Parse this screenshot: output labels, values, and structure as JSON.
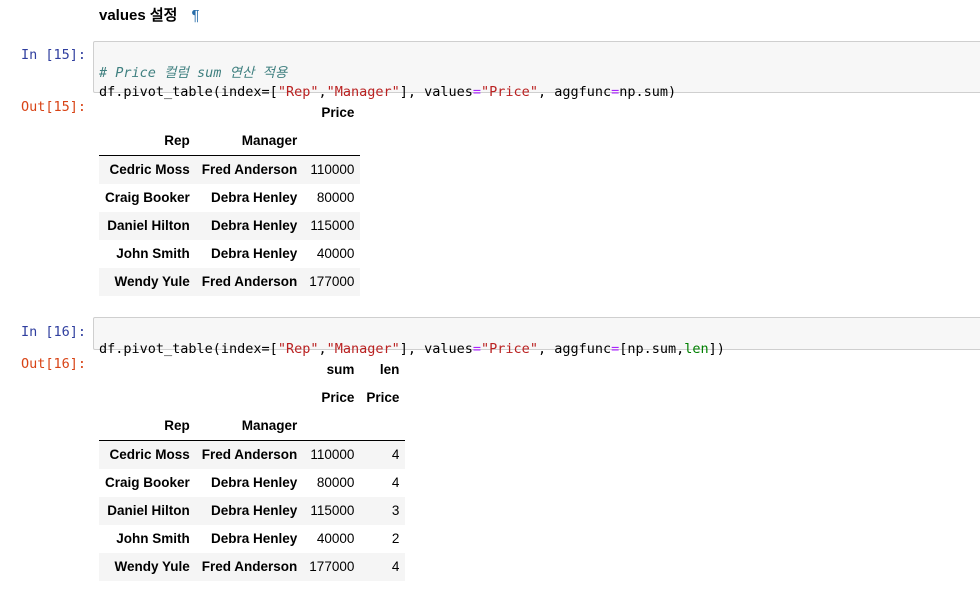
{
  "heading": {
    "text": "values 설정",
    "pilcrow": "¶"
  },
  "cell15": {
    "in_prompt": "In [15]:",
    "out_prompt": "Out[15]:",
    "comment": "# Price 컬럼 sum 연산 적용",
    "code_parts": [
      "df.pivot_table(index=[",
      "\"Rep\"",
      ",",
      "\"Manager\"",
      "], values",
      "=",
      "\"Price\"",
      ", aggfunc",
      "=",
      "np.sum)"
    ],
    "table": {
      "col_header": "Price",
      "index_names": [
        "Rep",
        "Manager"
      ],
      "rows": [
        {
          "rep": "Cedric Moss",
          "manager": "Fred Anderson",
          "price": "110000"
        },
        {
          "rep": "Craig Booker",
          "manager": "Debra Henley",
          "price": "80000"
        },
        {
          "rep": "Daniel Hilton",
          "manager": "Debra Henley",
          "price": "115000"
        },
        {
          "rep": "John Smith",
          "manager": "Debra Henley",
          "price": "40000"
        },
        {
          "rep": "Wendy Yule",
          "manager": "Fred Anderson",
          "price": "177000"
        }
      ]
    }
  },
  "cell16": {
    "in_prompt": "In [16]:",
    "out_prompt": "Out[16]:",
    "code_parts": [
      "df.pivot_table(index=[",
      "\"Rep\"",
      ",",
      "\"Manager\"",
      "], values",
      "=",
      "\"Price\"",
      ", aggfunc",
      "=",
      "[np.sum,",
      "len",
      "])"
    ],
    "table": {
      "col_header_l0": [
        "sum",
        "len"
      ],
      "col_header_l1": [
        "Price",
        "Price"
      ],
      "index_names": [
        "Rep",
        "Manager"
      ],
      "rows": [
        {
          "rep": "Cedric Moss",
          "manager": "Fred Anderson",
          "sum": "110000",
          "len": "4"
        },
        {
          "rep": "Craig Booker",
          "manager": "Debra Henley",
          "sum": "80000",
          "len": "4"
        },
        {
          "rep": "Daniel Hilton",
          "manager": "Debra Henley",
          "sum": "115000",
          "len": "3"
        },
        {
          "rep": "John Smith",
          "manager": "Debra Henley",
          "sum": "40000",
          "len": "2"
        },
        {
          "rep": "Wendy Yule",
          "manager": "Fred Anderson",
          "sum": "177000",
          "len": "4"
        }
      ]
    }
  }
}
